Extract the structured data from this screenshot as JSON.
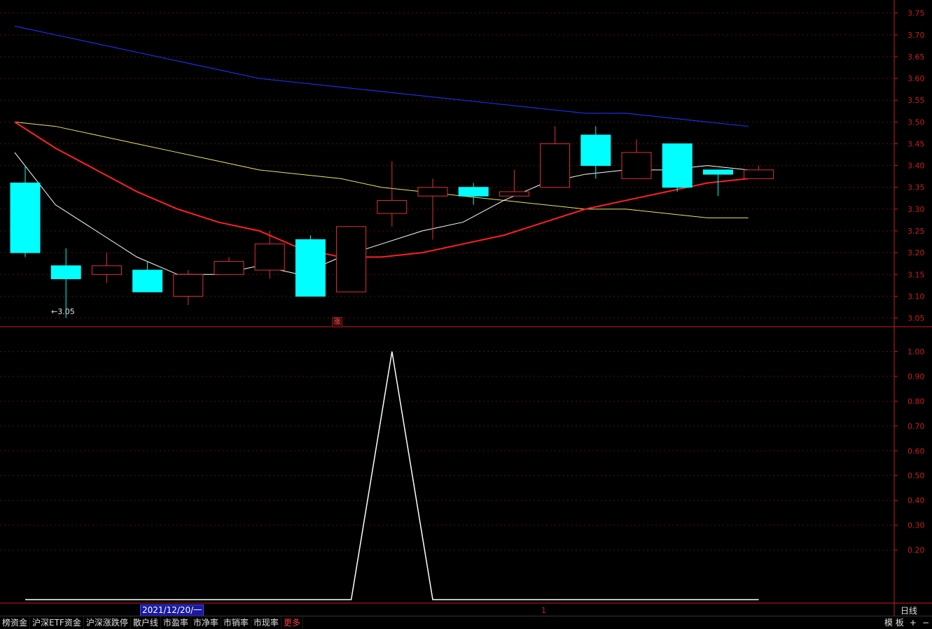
{
  "price_axis": {
    "ticks": [
      "3.75",
      "3.70",
      "3.65",
      "3.60",
      "3.55",
      "3.50",
      "3.45",
      "3.40",
      "3.35",
      "3.30",
      "3.25",
      "3.20",
      "3.15",
      "3.10",
      "3.05"
    ]
  },
  "indicator_axis": {
    "ticks": [
      "1.00",
      "0.90",
      "0.80",
      "0.70",
      "0.60",
      "0.50",
      "0.40",
      "0.30",
      "0.20"
    ]
  },
  "annotations": {
    "low_label": "←3.05",
    "zhang_badge": "涨",
    "cursor_marker": "1"
  },
  "footer": {
    "date_box": "2021/12/20/一",
    "period": "日线"
  },
  "tabs": [
    {
      "label": "榜资金"
    },
    {
      "label": "沪深ETF资金"
    },
    {
      "label": "沪深涨跌停"
    },
    {
      "label": "散户线"
    },
    {
      "label": "市盈率"
    },
    {
      "label": "市净率"
    },
    {
      "label": "市销率"
    },
    {
      "label": "市现率"
    },
    {
      "label": "更多"
    }
  ],
  "tab_controls": {
    "template": "模 板",
    "plus": "+",
    "minus": "−"
  },
  "colors": {
    "up": "#e0303a",
    "down": "#00ffff",
    "ma_white": "#ffffff",
    "ma_red": "#ff2020",
    "ma_yellow": "#e8e860",
    "ma_blue": "#1a2ee6",
    "axis": "#c81e1e"
  },
  "chart_data": {
    "type": "candlestick",
    "price_range": [
      3.03,
      3.78
    ],
    "candles": [
      {
        "o": 3.36,
        "h": 3.4,
        "l": 3.19,
        "c": 3.2,
        "dir": "down"
      },
      {
        "o": 3.17,
        "h": 3.21,
        "l": 3.05,
        "c": 3.14,
        "dir": "down"
      },
      {
        "o": 3.15,
        "h": 3.2,
        "l": 3.13,
        "c": 3.17,
        "dir": "up"
      },
      {
        "o": 3.16,
        "h": 3.18,
        "l": 3.11,
        "c": 3.11,
        "dir": "down"
      },
      {
        "o": 3.1,
        "h": 3.16,
        "l": 3.08,
        "c": 3.15,
        "dir": "up"
      },
      {
        "o": 3.15,
        "h": 3.19,
        "l": 3.15,
        "c": 3.18,
        "dir": "up"
      },
      {
        "o": 3.16,
        "h": 3.25,
        "l": 3.14,
        "c": 3.22,
        "dir": "up"
      },
      {
        "o": 3.23,
        "h": 3.24,
        "l": 3.1,
        "c": 3.1,
        "dir": "down"
      },
      {
        "o": 3.11,
        "h": 3.26,
        "l": 3.11,
        "c": 3.26,
        "dir": "up"
      },
      {
        "o": 3.29,
        "h": 3.41,
        "l": 3.26,
        "c": 3.32,
        "dir": "up"
      },
      {
        "o": 3.33,
        "h": 3.37,
        "l": 3.23,
        "c": 3.35,
        "dir": "up"
      },
      {
        "o": 3.35,
        "h": 3.36,
        "l": 3.31,
        "c": 3.33,
        "dir": "down"
      },
      {
        "o": 3.33,
        "h": 3.39,
        "l": 3.33,
        "c": 3.34,
        "dir": "up"
      },
      {
        "o": 3.35,
        "h": 3.49,
        "l": 3.35,
        "c": 3.45,
        "dir": "up"
      },
      {
        "o": 3.47,
        "h": 3.49,
        "l": 3.37,
        "c": 3.4,
        "dir": "down"
      },
      {
        "o": 3.37,
        "h": 3.46,
        "l": 3.37,
        "c": 3.43,
        "dir": "up"
      },
      {
        "o": 3.45,
        "h": 3.45,
        "l": 3.34,
        "c": 3.35,
        "dir": "down"
      },
      {
        "o": 3.39,
        "h": 3.39,
        "l": 3.33,
        "c": 3.38,
        "dir": "down"
      },
      {
        "o": 3.37,
        "h": 3.4,
        "l": 3.37,
        "c": 3.39,
        "dir": "up"
      }
    ],
    "ma_white": [
      3.43,
      3.31,
      3.25,
      3.19,
      3.15,
      3.15,
      3.17,
      3.15,
      3.19,
      3.22,
      3.25,
      3.27,
      3.32,
      3.36,
      3.38,
      3.39,
      3.39,
      3.4,
      3.39
    ],
    "ma_red": [
      3.5,
      3.44,
      3.39,
      3.34,
      3.3,
      3.27,
      3.25,
      3.21,
      3.19,
      3.19,
      3.2,
      3.22,
      3.24,
      3.27,
      3.3,
      3.32,
      3.34,
      3.36,
      3.37
    ],
    "ma_yellow": [
      3.5,
      3.49,
      3.47,
      3.45,
      3.43,
      3.41,
      3.39,
      3.38,
      3.37,
      3.35,
      3.34,
      3.33,
      3.32,
      3.31,
      3.3,
      3.3,
      3.29,
      3.28,
      3.28
    ],
    "ma_blue": [
      3.72,
      3.7,
      3.68,
      3.66,
      3.64,
      3.62,
      3.6,
      3.59,
      3.58,
      3.57,
      3.56,
      3.55,
      3.54,
      3.53,
      3.52,
      3.52,
      3.51,
      3.5,
      3.49
    ],
    "indicator_range": [
      0,
      1.1
    ],
    "indicator_values": [
      0,
      0,
      0,
      0,
      0,
      0,
      0,
      0,
      0,
      1,
      0,
      0,
      0,
      0,
      0,
      0,
      0,
      0,
      0
    ]
  }
}
